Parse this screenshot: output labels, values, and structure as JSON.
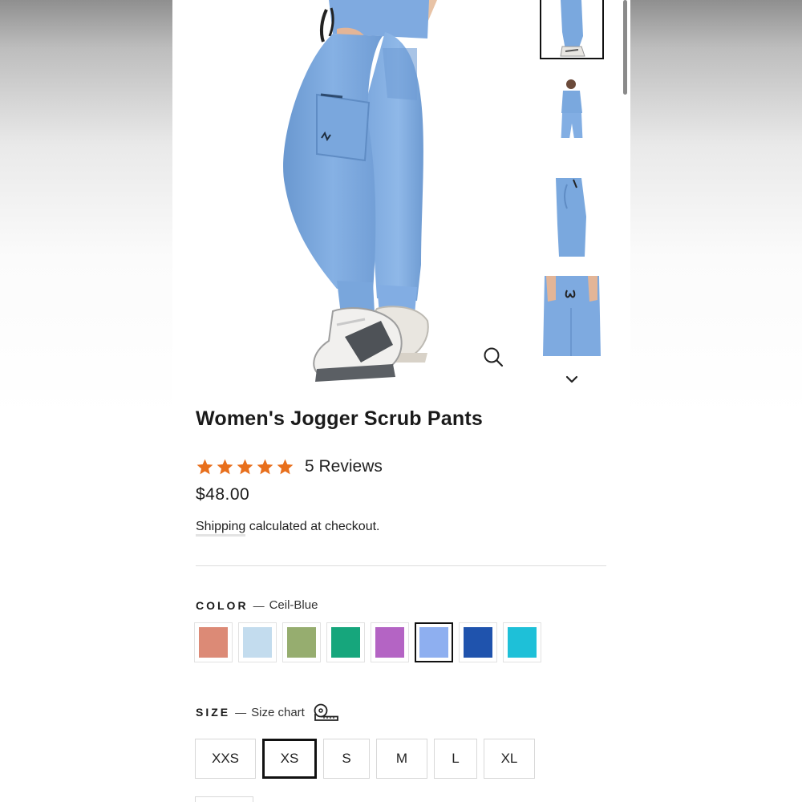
{
  "product": {
    "title": "Women's Jogger Scrub Pants",
    "rating": 5,
    "reviews_label": "5 Reviews",
    "price": "$48.00",
    "shipping_link": "Shipping",
    "shipping_rest": " calculated at checkout."
  },
  "icons": {
    "zoom": "magnifier-icon",
    "thumbs_down": "chevron-down-icon",
    "star": "star-icon",
    "size_chart": "ruler-tape-icon"
  },
  "color": {
    "label": "COLOR",
    "dash": "—",
    "selected": "Ceil-Blue",
    "swatches": [
      {
        "hex": "#dc8a76",
        "selected": false
      },
      {
        "hex": "#c3dcee",
        "selected": false
      },
      {
        "hex": "#96ad6f",
        "selected": false
      },
      {
        "hex": "#16a67c",
        "selected": false
      },
      {
        "hex": "#b464c4",
        "selected": false
      },
      {
        "hex": "#8eaff0",
        "selected": true
      },
      {
        "hex": "#1f53ad",
        "selected": false
      },
      {
        "hex": "#1ec0d8",
        "selected": false
      }
    ]
  },
  "size": {
    "label": "SIZE",
    "dash": "—",
    "chart_link": "Size chart",
    "options": [
      "XXS",
      "XS",
      "S",
      "M",
      "L",
      "XL"
    ],
    "selected": "XS"
  },
  "theme": {
    "star_color": "#e86f1c",
    "scrub_color": "#7ea9dd",
    "text_color": "#1a1a1a"
  }
}
